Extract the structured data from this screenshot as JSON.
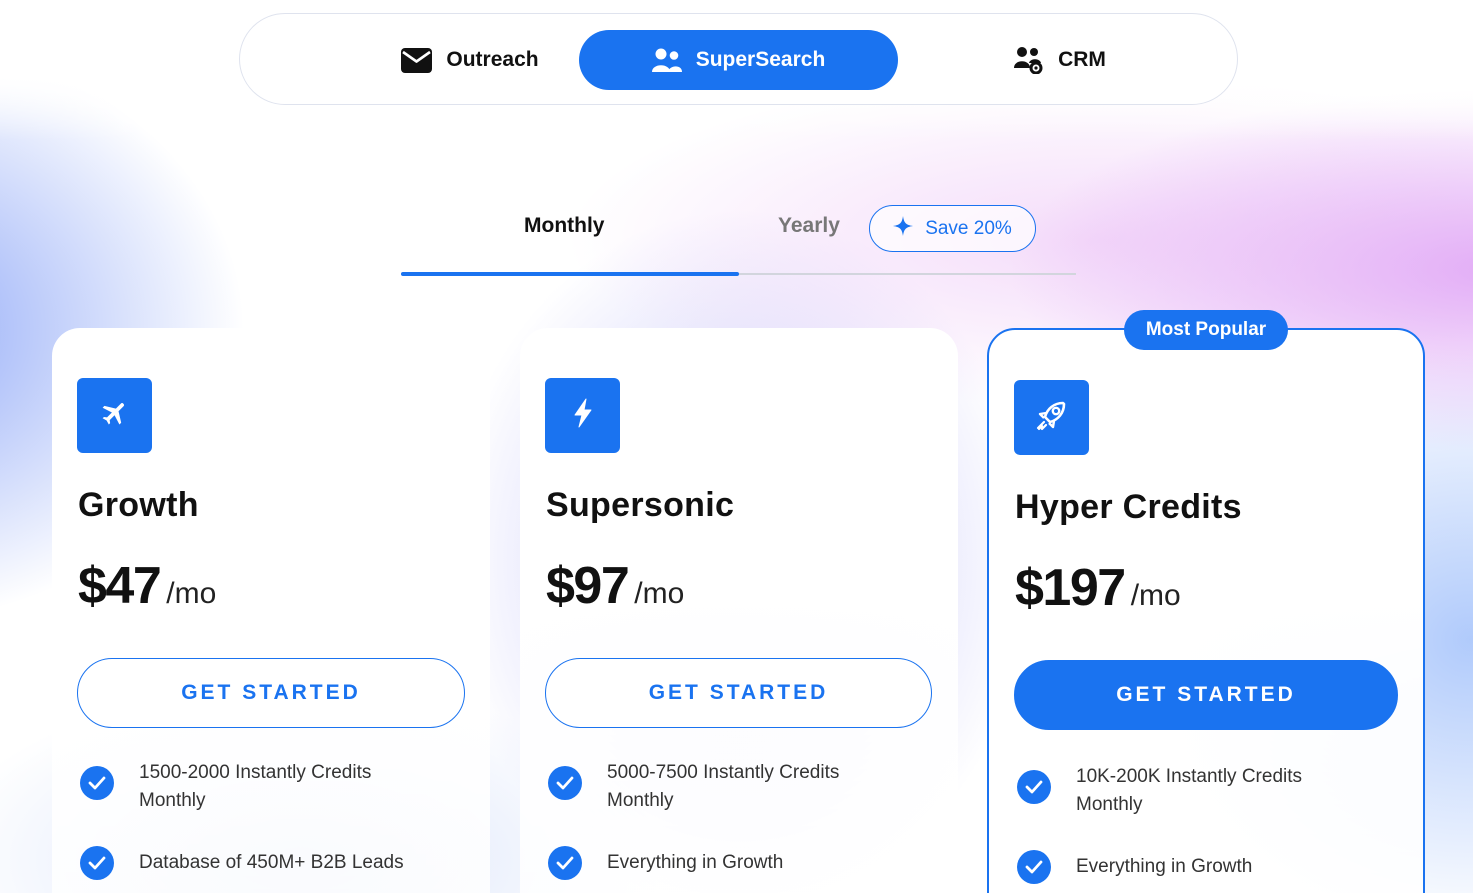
{
  "product_tabs": [
    {
      "label": "Outreach",
      "icon": "envelope-icon",
      "active": false
    },
    {
      "label": "SuperSearch",
      "icon": "users-icon",
      "active": true
    },
    {
      "label": "CRM",
      "icon": "user-gear-icon",
      "active": false
    }
  ],
  "billing": {
    "monthly_label": "Monthly",
    "yearly_label": "Yearly",
    "save_label": "Save 20%",
    "selected": "Monthly"
  },
  "most_popular_label": "Most Popular",
  "colors": {
    "accent": "#1a73f0"
  },
  "plans": [
    {
      "name": "Growth",
      "icon": "plane-icon",
      "price": "$47",
      "period": "/mo",
      "cta": "GET STARTED",
      "features": [
        "1500-2000 Instantly Credits Monthly",
        "Database of 450M+ B2B Leads"
      ]
    },
    {
      "name": "Supersonic",
      "icon": "lightning-icon",
      "price": "$97",
      "period": "/mo",
      "cta": "GET STARTED",
      "features": [
        "5000-7500 Instantly Credits Monthly",
        "Everything in Growth"
      ]
    },
    {
      "name": "Hyper Credits",
      "icon": "rocket-icon",
      "price": "$197",
      "period": "/mo",
      "cta": "GET STARTED",
      "features": [
        "10K-200K Instantly Credits Monthly",
        "Everything in Growth"
      ]
    }
  ]
}
